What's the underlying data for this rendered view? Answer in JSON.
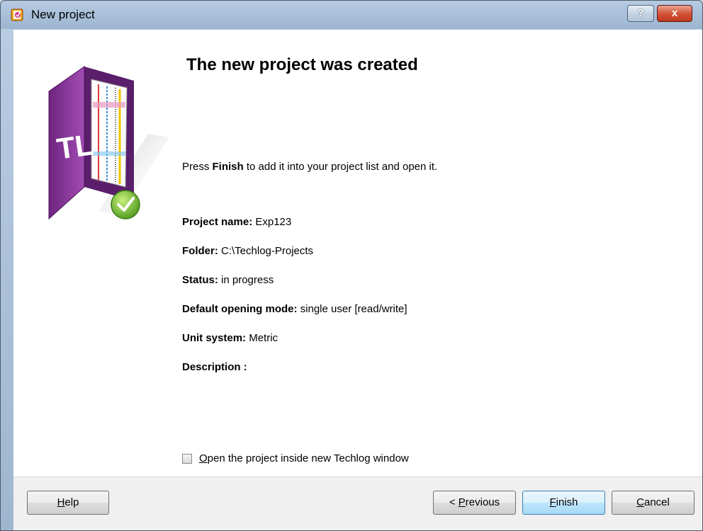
{
  "window": {
    "title": "New project",
    "help_glyph": "?",
    "close_glyph": "x"
  },
  "main": {
    "heading": "The new project was created",
    "instruction_prefix": "Press ",
    "instruction_bold": "Finish",
    "instruction_suffix": " to add it into your project list and open it.",
    "fields": [
      {
        "label": "Project name:",
        "value": " Exp123"
      },
      {
        "label": "Folder:",
        "value": " C:\\Techlog-Projects"
      },
      {
        "label": "Status:",
        "value": " in progress"
      },
      {
        "label": "Default opening mode:",
        "value": " single user [read/write]"
      },
      {
        "label": "Unit system:",
        "value": " Metric"
      },
      {
        "label": "Description :",
        "value": ""
      }
    ],
    "checkbox_label_accel": "O",
    "checkbox_label_rest": "pen the project inside new Techlog window",
    "checkbox_checked": false
  },
  "footer": {
    "help_accel": "H",
    "help_rest": "elp",
    "previous_prefix": "< ",
    "previous_accel": "P",
    "previous_rest": "revious",
    "finish_accel": "F",
    "finish_rest": "inish",
    "cancel_accel": "C",
    "cancel_rest": "ancel"
  },
  "icons": {
    "title_icon": "techlog-app-icon",
    "logo": "techlog-folder-logo",
    "check_badge": "check-icon"
  },
  "colors": {
    "brand_purple": "#7a2f8a",
    "check_green": "#7cc242",
    "primary_button": "#bee6fd"
  }
}
